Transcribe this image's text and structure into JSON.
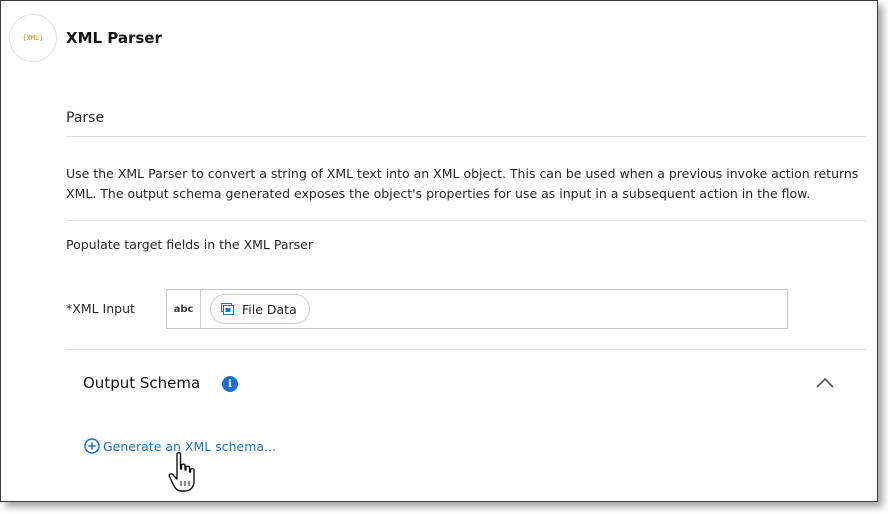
{
  "header": {
    "logo_text": "{XML}",
    "title": "XML Parser"
  },
  "action": {
    "section_title": "Parse",
    "description": "Use the XML Parser to convert a string of XML text into an XML object. This can be used when a previous invoke action returns XML. The output schema generated exposes the object's properties for use as input in a subsequent action in the flow.",
    "populate_text": "Populate target fields in the XML Parser"
  },
  "xml_input": {
    "label": "*XML Input",
    "type_tag": "abc",
    "value_pill": "File Data"
  },
  "output_schema": {
    "title": "Output Schema",
    "info_icon": "i",
    "generate_link": "Generate an XML schema..."
  },
  "colors": {
    "accent_link": "#1f72c4",
    "info_badge": "#1f6fd1",
    "logo_text": "#d08a14"
  }
}
